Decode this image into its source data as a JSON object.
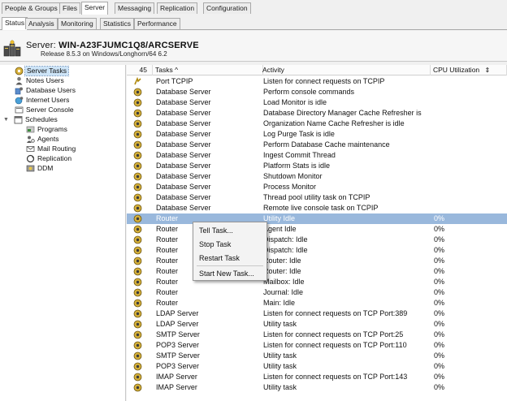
{
  "tabs_top": [
    "People & Groups",
    "Files",
    "Server",
    "Messaging",
    "Replication",
    "Configuration"
  ],
  "tabs_sub": [
    "Status",
    "Analysis",
    "Monitoring",
    "Statistics",
    "Performance"
  ],
  "server": {
    "label": "Server:",
    "name": "WIN-A23FJUMC1Q8/ARCSERVE",
    "release": "Release 8.5.3 on Windows/Longhorn/64 6.2"
  },
  "tree": [
    "Server Tasks",
    "Notes Users",
    "Database Users",
    "Internet Users",
    "Server Console",
    "Schedules",
    "Programs",
    "Agents",
    "Mail Routing",
    "Replication",
    "DDM"
  ],
  "grid": {
    "count": "45",
    "headers": [
      "Tasks ^",
      "Activity",
      "CPU Utilization"
    ],
    "rows": [
      {
        "task": "Port TCPIP",
        "activity": "Listen for connect requests on TCPIP",
        "cpu": ""
      },
      {
        "task": "Database Server",
        "activity": "Perform console commands",
        "cpu": ""
      },
      {
        "task": "Database Server",
        "activity": "Load Monitor is idle",
        "cpu": ""
      },
      {
        "task": "Database Server",
        "activity": "Database Directory Manager Cache Refresher is",
        "cpu": ""
      },
      {
        "task": "Database Server",
        "activity": "Organization Name Cache Refresher is idle",
        "cpu": ""
      },
      {
        "task": "Database Server",
        "activity": "Log Purge Task is idle",
        "cpu": ""
      },
      {
        "task": "Database Server",
        "activity": "Perform Database Cache maintenance",
        "cpu": ""
      },
      {
        "task": "Database Server",
        "activity": "Ingest Commit Thread",
        "cpu": ""
      },
      {
        "task": "Database Server",
        "activity": "Platform Stats is idle",
        "cpu": ""
      },
      {
        "task": "Database Server",
        "activity": "Shutdown Monitor",
        "cpu": ""
      },
      {
        "task": "Database Server",
        "activity": "Process Monitor",
        "cpu": ""
      },
      {
        "task": "Database Server",
        "activity": "Thread pool utility task on TCPIP",
        "cpu": ""
      },
      {
        "task": "Database Server",
        "activity": "Remote live console task on TCPIP",
        "cpu": ""
      },
      {
        "task": "Router",
        "activity": "Utility Idle",
        "cpu": "0%"
      },
      {
        "task": "Router",
        "activity": "Agent Idle",
        "cpu": "0%"
      },
      {
        "task": "Router",
        "activity": "Dispatch: Idle",
        "cpu": "0%"
      },
      {
        "task": "Router",
        "activity": "Dispatch: Idle",
        "cpu": "0%"
      },
      {
        "task": "Router",
        "activity": "Router: Idle",
        "cpu": "0%"
      },
      {
        "task": "Router",
        "activity": "Router: Idle",
        "cpu": "0%"
      },
      {
        "task": "Router",
        "activity": "Mailbox: Idle",
        "cpu": "0%"
      },
      {
        "task": "Router",
        "activity": "Journal: Idle",
        "cpu": "0%"
      },
      {
        "task": "Router",
        "activity": "Main: Idle",
        "cpu": "0%"
      },
      {
        "task": "LDAP Server",
        "activity": "Listen for connect requests on TCP Port:389",
        "cpu": "0%"
      },
      {
        "task": "LDAP Server",
        "activity": "Utility task",
        "cpu": "0%"
      },
      {
        "task": "SMTP Server",
        "activity": "Listen for connect requests on TCP Port:25",
        "cpu": "0%"
      },
      {
        "task": "POP3 Server",
        "activity": "Listen for connect requests on TCP Port:110",
        "cpu": "0%"
      },
      {
        "task": "SMTP Server",
        "activity": "Utility task",
        "cpu": "0%"
      },
      {
        "task": "POP3 Server",
        "activity": "Utility task",
        "cpu": "0%"
      },
      {
        "task": "IMAP Server",
        "activity": "Listen for connect requests on TCP Port:143",
        "cpu": "0%"
      },
      {
        "task": "IMAP Server",
        "activity": "Utility task",
        "cpu": "0%"
      }
    ]
  },
  "context_menu": [
    "Tell Task...",
    "Stop Task",
    "Restart Task",
    "Start New Task..."
  ],
  "colors": {
    "selection": "#99b8dc",
    "tree_selection": "#cde4f7"
  }
}
